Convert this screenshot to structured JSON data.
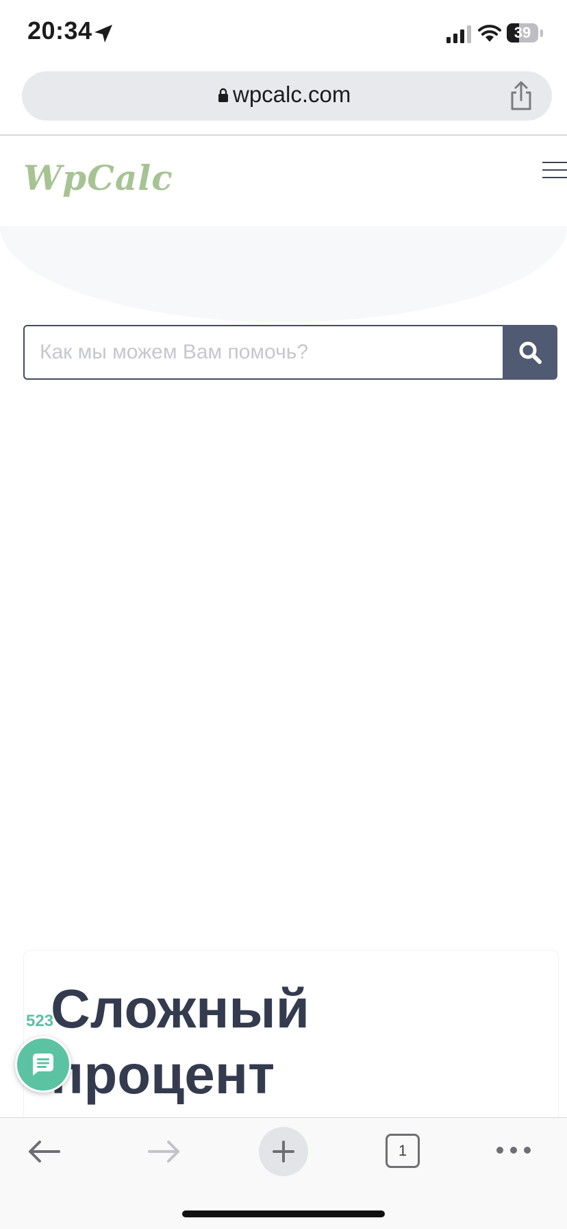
{
  "status_bar": {
    "time": "20:34",
    "battery_level": 39,
    "battery_label": "39"
  },
  "browser": {
    "url": "wpcalc.com",
    "tab_count": "1"
  },
  "site": {
    "logo_text": "WpCalc",
    "search": {
      "placeholder": "Как мы можем Вам помочь?",
      "value": ""
    }
  },
  "article": {
    "title": "Сложный процент"
  },
  "chat_widget": {
    "count": "523"
  },
  "colors": {
    "logo": "#a7c394",
    "search_button": "#505a72",
    "title_text": "#353b4f",
    "chat_accent": "#5cc3a2"
  },
  "icons": {
    "status": [
      "location-arrow-icon",
      "signal-bars-icon",
      "wifi-icon",
      "battery-icon"
    ],
    "address_bar": [
      "lock-icon",
      "share-icon"
    ],
    "site": [
      "hamburger-menu-icon",
      "search-icon",
      "chat-icon"
    ],
    "toolbar": [
      "back-arrow-icon",
      "forward-arrow-icon",
      "plus-icon",
      "tabs-icon",
      "more-dots-icon"
    ]
  }
}
